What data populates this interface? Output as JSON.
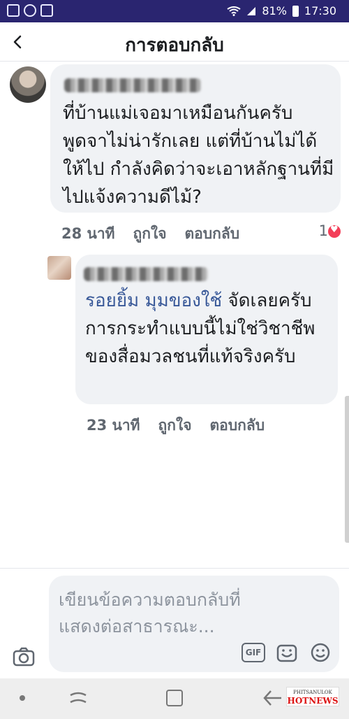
{
  "status_bar": {
    "battery": "81%",
    "time": "17:30",
    "icons": [
      "gallery-icon",
      "messenger-icon",
      "notification-icon",
      "wifi-icon",
      "signal-icon",
      "battery-icon"
    ]
  },
  "header": {
    "title": "การตอบกลับ",
    "back_icon": "back-arrow-icon"
  },
  "comment": {
    "author": "",
    "text": "ที่บ้านแม่เจอมาเหมือนกันครับ พูดจาไม่น่ารักเลย แต่ที่บ้านไม่ได้ให้ไป กำลังคิดว่าจะเอาหลักฐานที่มีไปแจ้งความดีไม้?",
    "time": "28 นาที",
    "like": "ถูกใจ",
    "reply": "ตอบกลับ",
    "reaction_count": "1",
    "reaction_icon": "love-reaction-icon"
  },
  "reply": {
    "author": "",
    "mention": "รอยยิ้ม มุมของใช้",
    "text": " จัดเลยครับการกระทำแบบนี้ไม่ใช่วิชาชีพของสื่อมวลชนที่แท้จริงครับ",
    "time": "23 นาที",
    "like": "ถูกใจ",
    "reply": "ตอบกลับ"
  },
  "composer": {
    "placeholder": "เขียนข้อความตอบกลับที่แสดงต่อสาธารณะ...",
    "gif_label": "GIF",
    "icons": [
      "camera-icon",
      "gif-icon",
      "sticker-icon",
      "emoji-icon"
    ]
  },
  "watermark": {
    "line1": "PHITSANULOK",
    "line2": "HOTNEWS"
  },
  "colors": {
    "status_bar": "#2a2570",
    "bubble": "#f0f2f5",
    "mention": "#385898",
    "love": "#f33e58"
  }
}
